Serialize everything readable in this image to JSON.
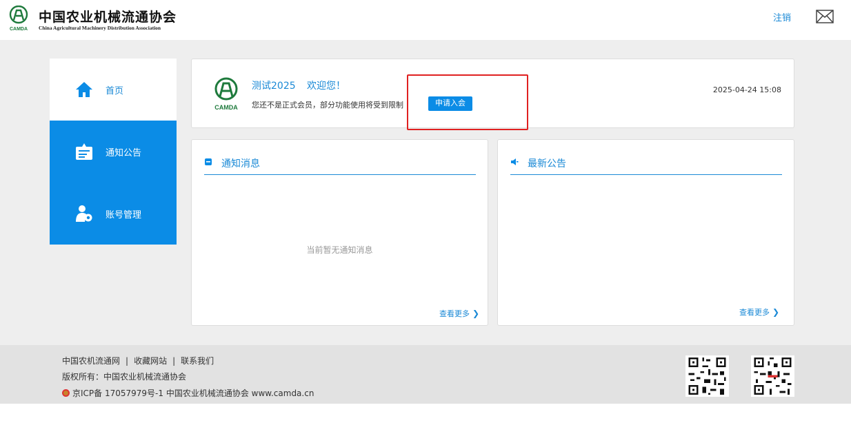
{
  "header": {
    "logo_cn": "中国农业机械流通协会",
    "logo_en": "China Agricultural Machinery Distribution Association",
    "logo_abbr": "CAMDA",
    "logout_label": "注销",
    "mail_icon": "mail-icon"
  },
  "sidebar": {
    "items": [
      {
        "label": "首页",
        "icon": "home-icon",
        "active": true
      },
      {
        "label": "通知公告",
        "icon": "notice-board-icon",
        "active": false
      },
      {
        "label": "账号管理",
        "icon": "user-settings-icon",
        "active": false
      }
    ]
  },
  "welcome": {
    "username": "测试2025",
    "greeting": "欢迎您！",
    "notice": "您还不是正式会员，部分功能使用将受到限制",
    "apply_label": "申请入会",
    "datetime": "2025-04-24 15:08",
    "logo_abbr": "CAMDA"
  },
  "panels": {
    "notifications": {
      "title": "通知消息",
      "empty_text": "当前暂无通知消息",
      "more_label": "查看更多"
    },
    "announcements": {
      "title": "最新公告",
      "more_label": "查看更多"
    }
  },
  "footer": {
    "links": [
      "中国农机流通网",
      "收藏网站",
      "联系我们"
    ],
    "separator": "|",
    "copyright": "版权所有：中国农业机械流通协会",
    "icp": "京ICP备 17057979号-1 中国农业机械流通协会 www.camda.cn"
  },
  "colors": {
    "accent": "#0b8ce6",
    "link": "#1a89d6",
    "highlight": "#e02020",
    "logo_green": "#1e7a3c"
  }
}
